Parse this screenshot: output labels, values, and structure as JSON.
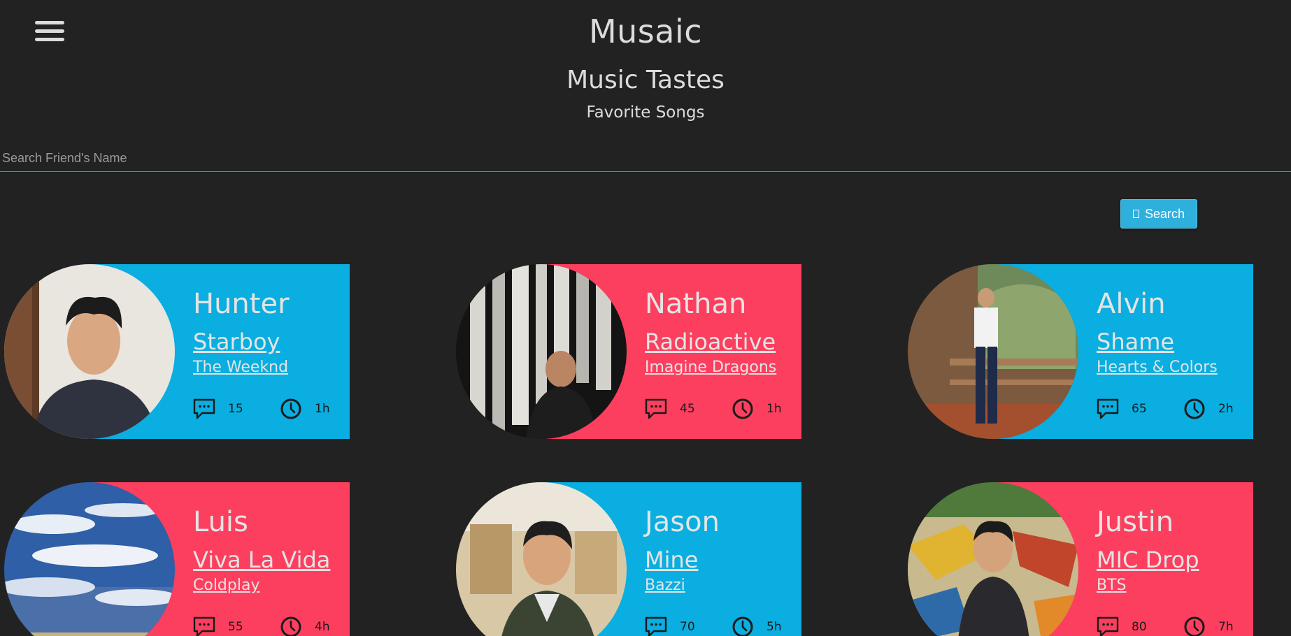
{
  "header": {
    "app_title": "Musaic",
    "section_title": "Music Tastes",
    "section_subtitle": "Favorite Songs"
  },
  "search": {
    "placeholder": "Search Friend's Name",
    "value": "",
    "button_label": "Search"
  },
  "colors": {
    "background": "#222222",
    "blue": "#0aaee0",
    "red": "#fc3f5f"
  },
  "cards": [
    {
      "name": "Hunter",
      "song": "Starboy",
      "artist": "The Weeknd",
      "comments": "15",
      "time": "1h",
      "band_color": "blue"
    },
    {
      "name": "Nathan",
      "song": "Radioactive",
      "artist": "Imagine Dragons",
      "comments": "45",
      "time": "1h",
      "band_color": "red"
    },
    {
      "name": "Alvin",
      "song": "Shame",
      "artist": "Hearts & Colors",
      "comments": "65",
      "time": "2h",
      "band_color": "blue"
    },
    {
      "name": "Luis",
      "song": "Viva La Vida",
      "artist": "Coldplay",
      "comments": "55",
      "time": "4h",
      "band_color": "red"
    },
    {
      "name": "Jason",
      "song": "Mine",
      "artist": "Bazzi",
      "comments": "70",
      "time": "5h",
      "band_color": "blue"
    },
    {
      "name": "Justin",
      "song": "MIC Drop",
      "artist": "BTS",
      "comments": "80",
      "time": "7h",
      "band_color": "red"
    }
  ]
}
